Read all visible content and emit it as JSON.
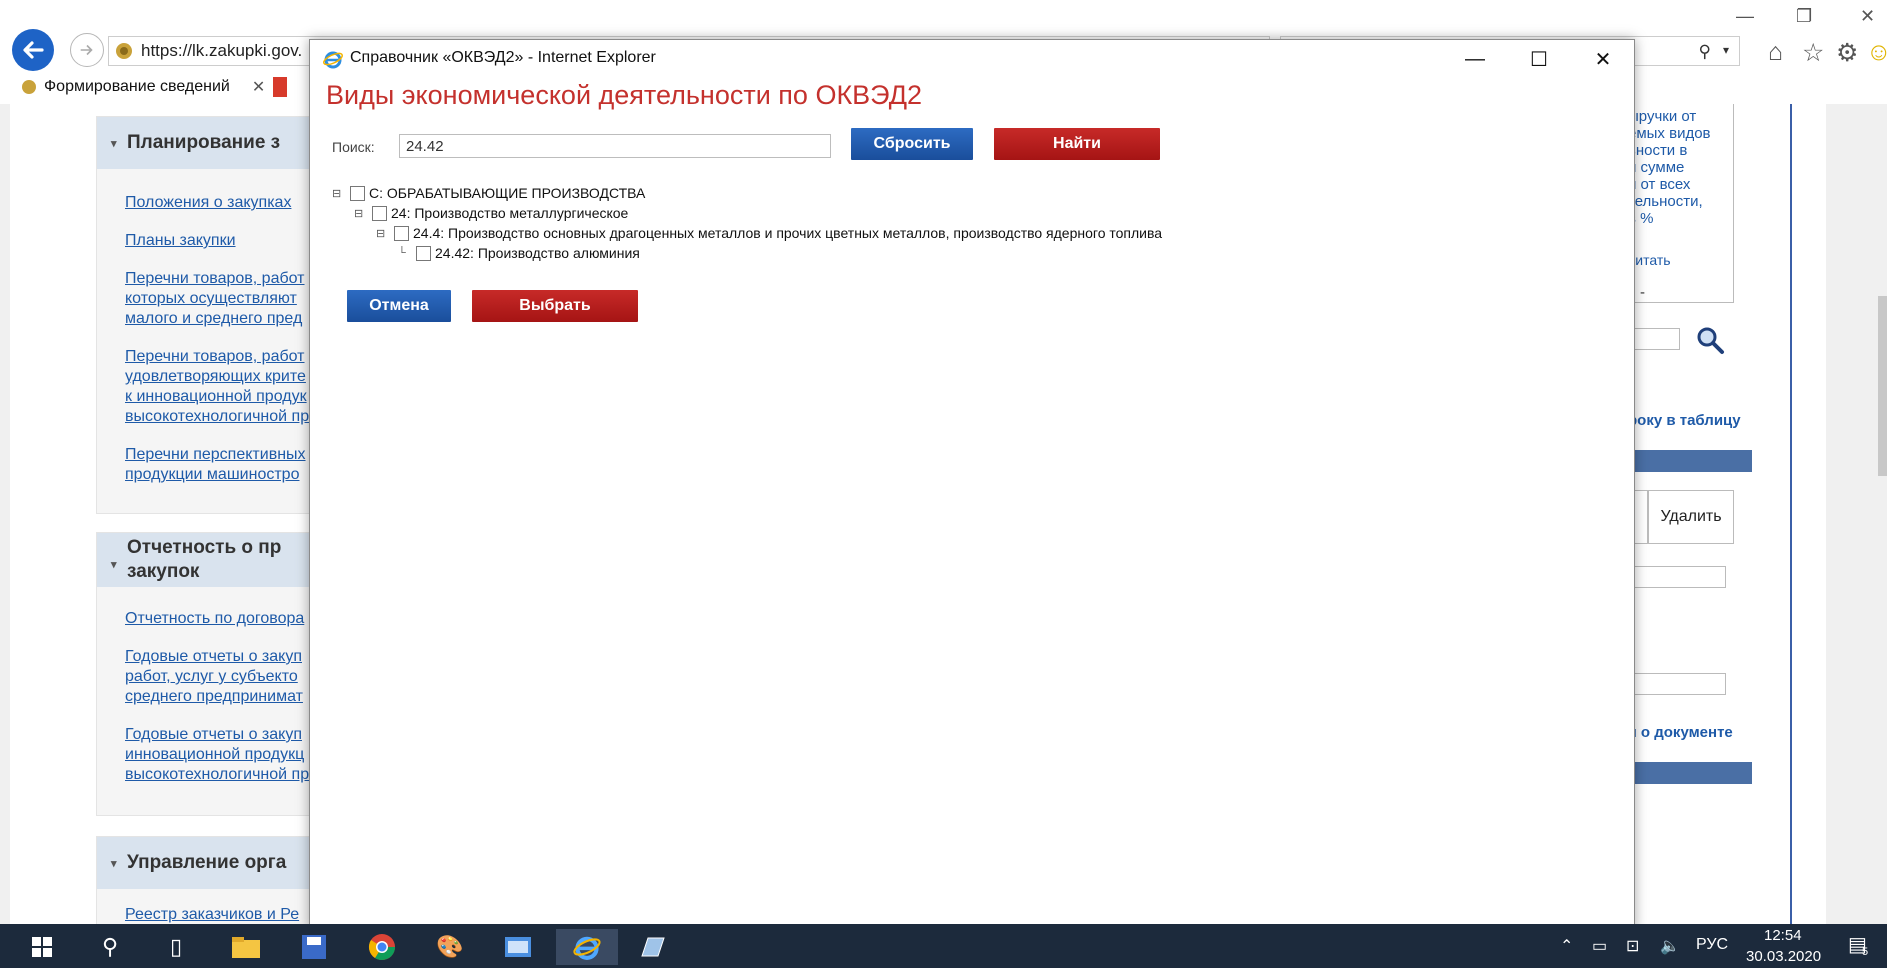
{
  "browser": {
    "url": "https://lk.zakupki.gov.",
    "tab_label": "Формирование сведений",
    "tab_close": "✕"
  },
  "page": {
    "panels": [
      {
        "title": "Планирование з",
        "links": [
          "Положения о закупках",
          "Планы закупки",
          "Перечни товаров, работ\nкоторых осуществляют\nмалого и среднего пред",
          "Перечни товаров, работ\nудовлетворяющих крите\nк инновационной продук\nвысокотехнологичной пр",
          "Перечни перспективных\nпродукции машиностро"
        ]
      },
      {
        "title": "Отчетность о пр\nзакупок",
        "links": [
          "Отчетность по договора",
          "Годовые отчеты о закуп\nработ, услуг у субъекто\nсреднего предпринимат",
          "Годовые отчеты о закуп\nинновационной продукц\nвысокотехнологичной пр"
        ]
      },
      {
        "title": "Управление орга",
        "links": [
          "Реестр заказчиков и Ре"
        ]
      }
    ],
    "right": {
      "info_text": "ыручки от\nемых видов\nьности в\nй сумме\nи от всех\nтельности,\nв %",
      "calc_link": "читать",
      "dash": "-",
      "add_row_link": "року в таблицу",
      "delete_button": "Удалить",
      "doc_info_link": "я о документе"
    }
  },
  "modal": {
    "window_title": "Справочник «ОКВЭД2» - Internet Explorer",
    "heading": "Виды экономической деятельности по ОКВЭД2",
    "search_label": "Поиск:",
    "search_value": "24.42",
    "reset_label": "Сбросить",
    "find_label": "Найти",
    "tree": [
      {
        "label": "C: ОБРАБАТЫВАЮЩИЕ ПРОИЗВОДСТВА",
        "level": 0
      },
      {
        "label": "24: Производство металлургическое",
        "level": 1
      },
      {
        "label": "24.4: Производство основных драгоценных металлов и прочих цветных металлов, производство ядерного топлива",
        "level": 2
      },
      {
        "label": "24.42: Производство алюминия",
        "level": 3
      }
    ],
    "cancel_label": "Отмена",
    "select_label": "Выбрать"
  },
  "taskbar": {
    "lang": "РУС",
    "time": "12:54",
    "date": "30.03.2020",
    "notification_count": "5"
  },
  "colors": {
    "heading_red": "#c4312d",
    "btn_blue": "#1a4e9b",
    "btn_red": "#a51414",
    "link_blue": "#1e5aa8",
    "taskbar": "#1c2a3c"
  }
}
